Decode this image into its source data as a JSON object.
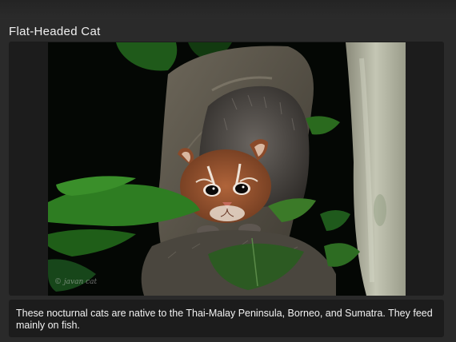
{
  "card": {
    "title": "Flat-Headed Cat",
    "caption": "These nocturnal cats are native to the Thai-Malay Peninsula, Borneo, and Sumatra. They feed mainly on fish."
  },
  "photo": {
    "subject": "flat-headed cat on a tree branch at night",
    "watermark": "© javan cat"
  },
  "colors": {
    "page_background": "#2a2a2a",
    "panel_background": "#1c1c1c",
    "text": "#f2f2f2"
  }
}
